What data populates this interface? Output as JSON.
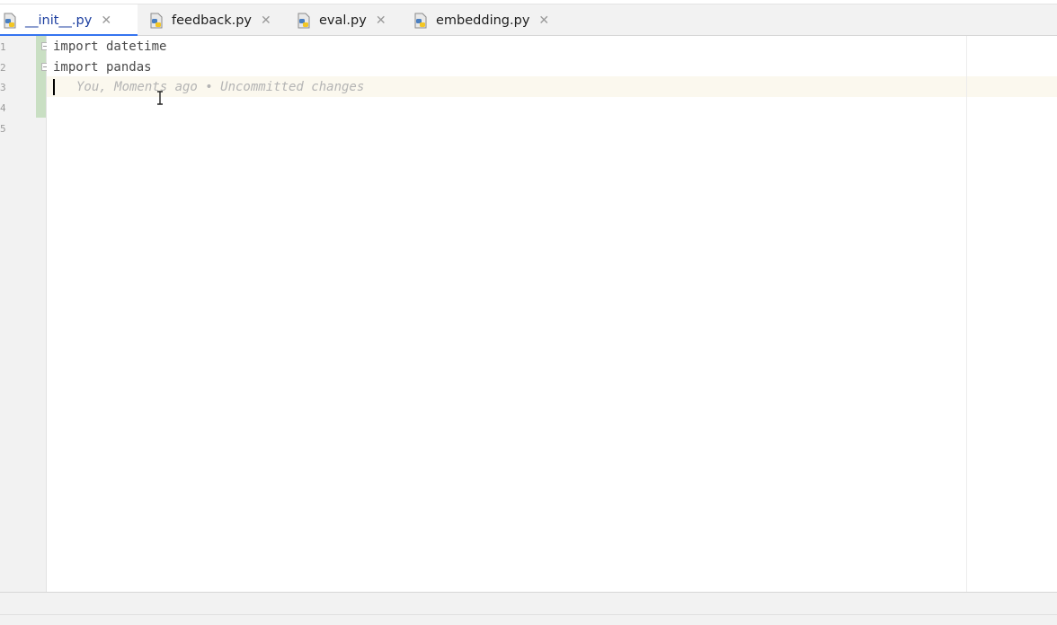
{
  "tabs": [
    {
      "label": "__init__.py",
      "active": true
    },
    {
      "label": "feedback.py",
      "active": false
    },
    {
      "label": "eval.py",
      "active": false
    },
    {
      "label": "embedding.py",
      "active": false
    }
  ],
  "tab_close_glyph": "✕",
  "tab_icon": "python-file-icon",
  "gutter": {
    "line_numbers": [
      "1",
      "2",
      "3",
      "4",
      "5"
    ]
  },
  "editor": {
    "lines": [
      "import datetime",
      "import pandas",
      ""
    ],
    "inline_blame": "You, Moments ago • Uncommitted changes"
  },
  "colors": {
    "active_tab_underline": "#3574f0",
    "active_tab_text": "#1d3fa0",
    "vcs_added": "#c9dfc3",
    "current_line_bg": "#fbf8ee"
  }
}
